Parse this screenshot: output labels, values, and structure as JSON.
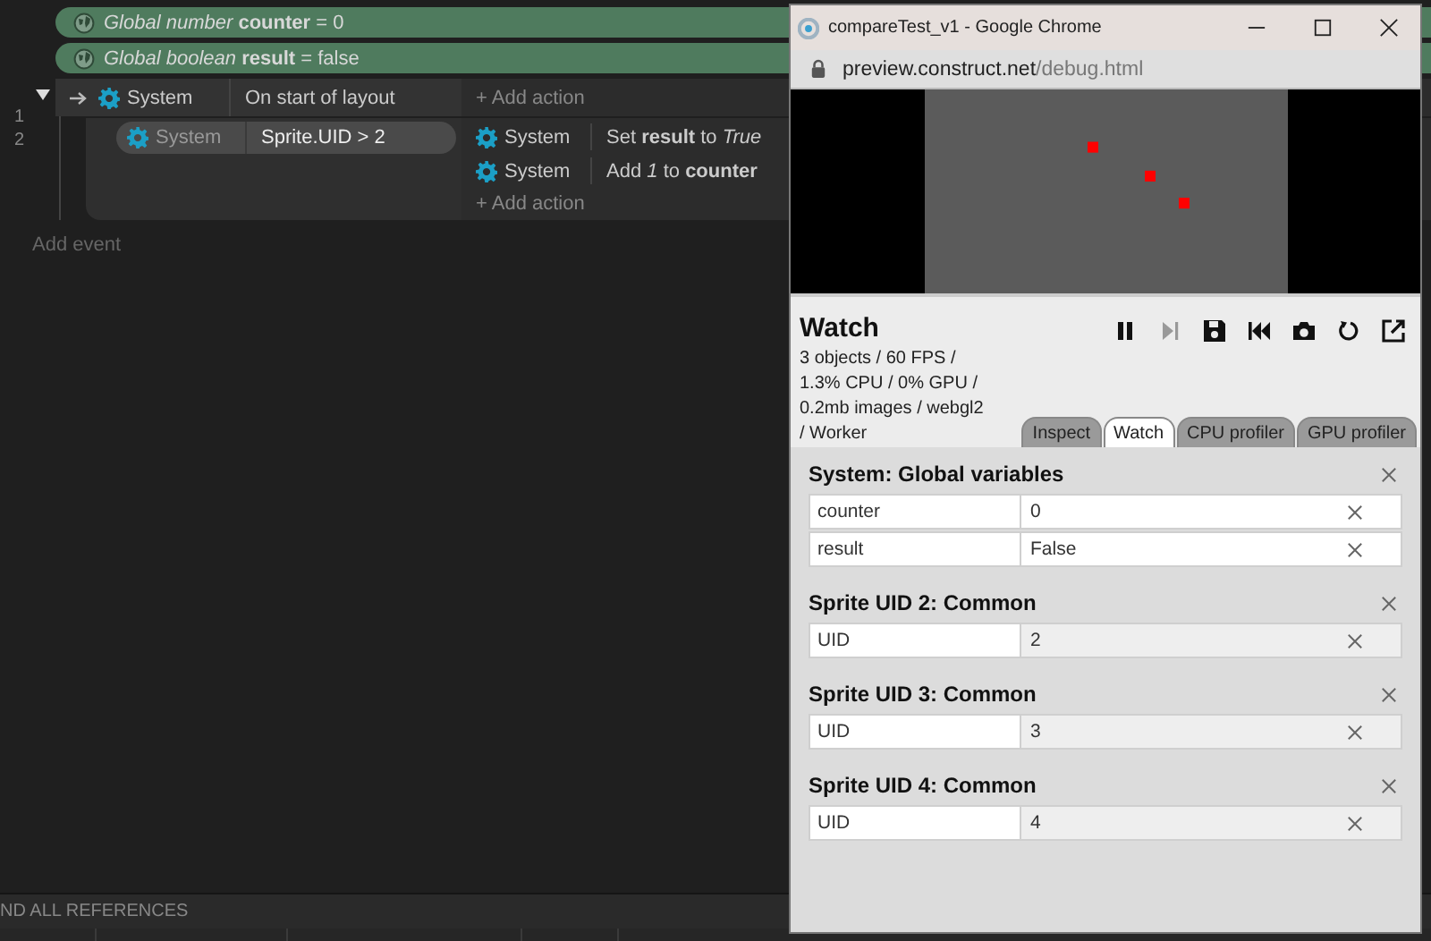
{
  "global_variables": [
    {
      "text": "*Global number* **counter** = 0"
    },
    {
      "text": "*Global boolean* **result** = false"
    }
  ],
  "events": [
    {
      "number": "1",
      "expanded": true,
      "conditions": [
        {
          "object": "System",
          "text": "On start of layout",
          "selected": false
        }
      ],
      "add_action": "+ Add action",
      "children": [
        {
          "number": "2",
          "conditions": [
            {
              "object": "System",
              "text": "Sprite.UID > 2",
              "selected": true
            }
          ],
          "actions": [
            {
              "object": "System",
              "text": "Set **result** to *True*"
            },
            {
              "object": "System",
              "text": "Add *1* to **counter**"
            }
          ],
          "add_action": "+ Add action"
        }
      ]
    }
  ],
  "add_event": "Add event",
  "bottom_bar": {
    "label": "ND ALL REFERENCES"
  },
  "browser": {
    "title": "compareTest_v1 - Google Chrome",
    "url_host": "preview.construct.net",
    "url_path": "/debug.html",
    "debugger": {
      "title": "Watch",
      "stats": [
        "3 objects / 60 FPS /",
        "1.3% CPU / 0% GPU /",
        "0.2mb images / webgl2",
        "/ Worker"
      ],
      "toolbar": [
        {
          "kind": "pause",
          "disabled": false
        },
        {
          "kind": "step",
          "disabled": true
        },
        {
          "kind": "save",
          "disabled": false
        },
        {
          "kind": "rewind",
          "disabled": false
        },
        {
          "kind": "camera",
          "disabled": false
        },
        {
          "kind": "restart",
          "disabled": false
        },
        {
          "kind": "popout",
          "disabled": false
        }
      ],
      "tabs": [
        {
          "label": "Inspect",
          "selected": false
        },
        {
          "label": "Watch",
          "selected": true
        },
        {
          "label": "CPU profiler",
          "selected": false
        },
        {
          "label": "GPU profiler",
          "selected": false
        }
      ],
      "sections": [
        {
          "title": "System: Global variables",
          "rows": [
            {
              "name": "counter",
              "value": "0",
              "editable": true
            },
            {
              "name": "result",
              "value": "False",
              "editable": true
            }
          ]
        },
        {
          "title": "Sprite UID 2: Common",
          "rows": [
            {
              "name": "UID",
              "value": "2",
              "editable": false
            }
          ]
        },
        {
          "title": "Sprite UID 3: Common",
          "rows": [
            {
              "name": "UID",
              "value": "3",
              "editable": false
            }
          ]
        },
        {
          "title": "Sprite UID 4: Common",
          "rows": [
            {
              "name": "UID",
              "value": "4",
              "editable": false
            }
          ]
        }
      ]
    }
  }
}
